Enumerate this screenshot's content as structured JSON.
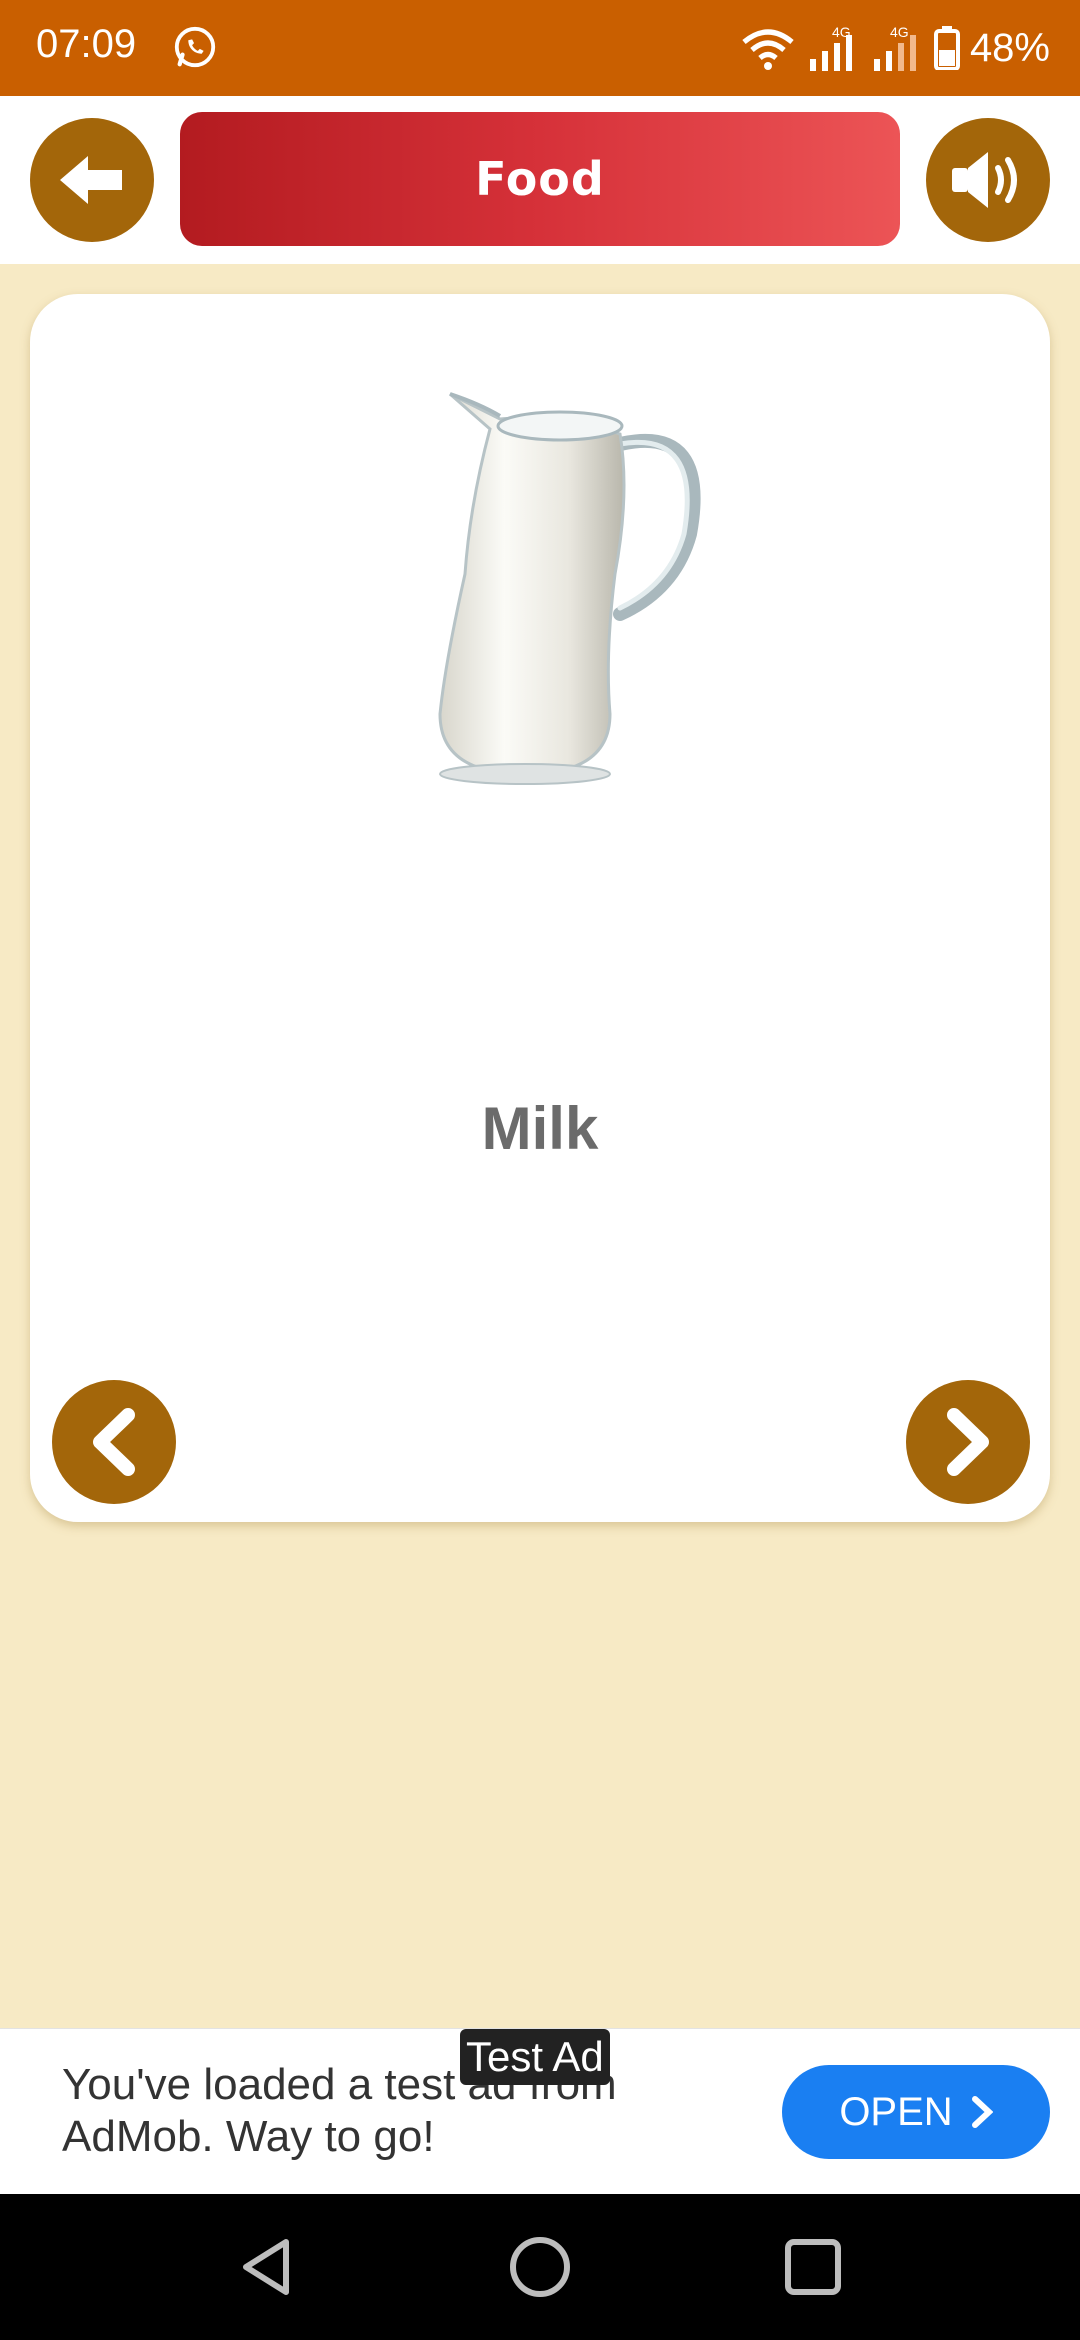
{
  "status": {
    "time": "07:09",
    "battery": "48%",
    "network_label": "4G"
  },
  "header": {
    "title": "Food"
  },
  "card": {
    "word": "Milk",
    "image": "milk-pitcher"
  },
  "ad": {
    "badge": "Test Ad",
    "message": "You've loaded a test ad from AdMob. Way to go!",
    "open_label": "OPEN"
  },
  "colors": {
    "status_bar": "#c95f00",
    "button": "#a3660a",
    "title_start": "#b31b20",
    "title_end": "#ec5456",
    "background": "#f7eac5",
    "ad_button": "#1a7ff2"
  },
  "icons": [
    "whatsapp-icon",
    "wifi-icon",
    "signal-icon",
    "battery-icon",
    "arrow-left-icon",
    "speaker-icon",
    "chevron-left-icon",
    "chevron-right-icon",
    "chevron-right-small-icon",
    "nav-back-icon",
    "nav-home-icon",
    "nav-recents-icon"
  ]
}
